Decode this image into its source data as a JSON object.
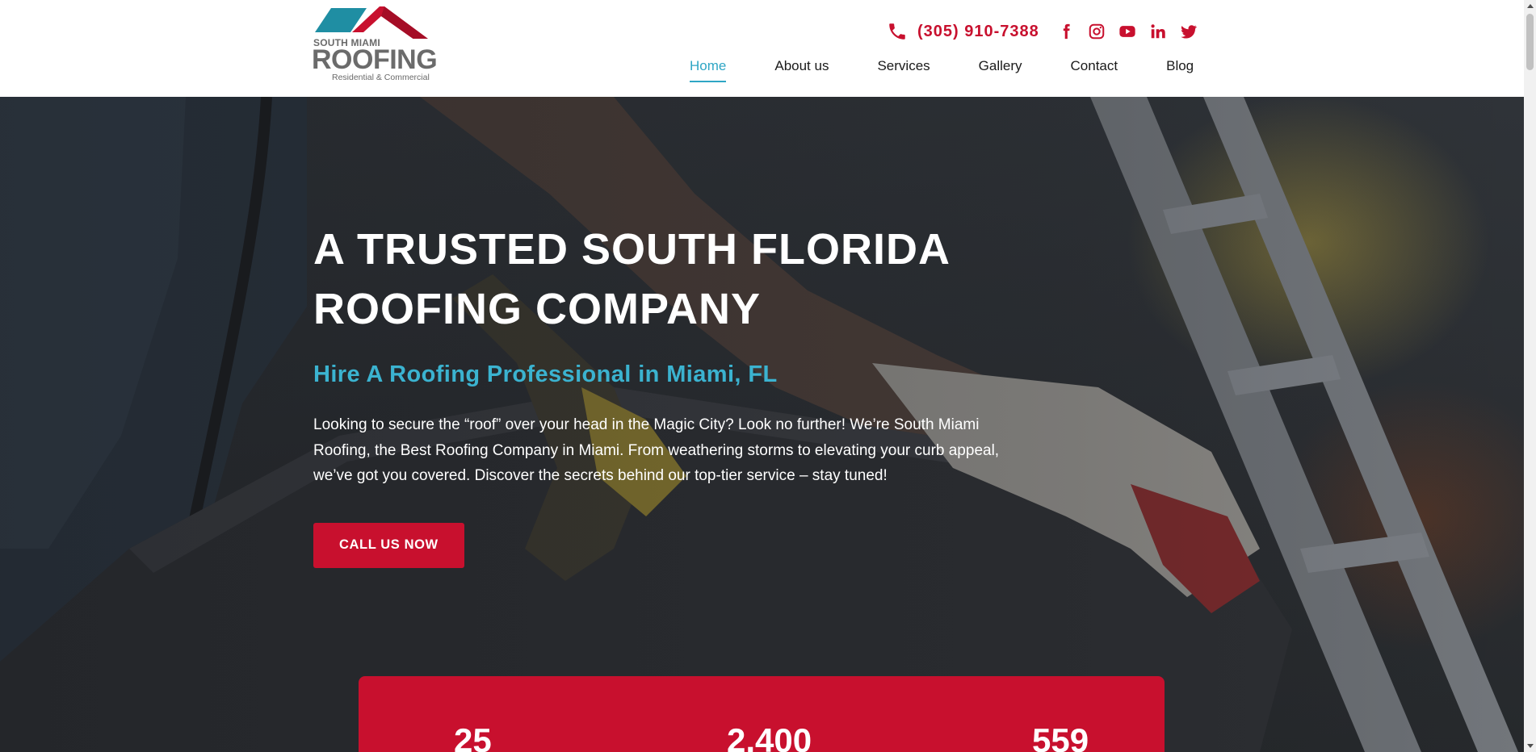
{
  "header": {
    "logo": {
      "line1": "SOUTH MIAMI",
      "line2": "ROOFING",
      "line3": "Residential & Commercial"
    },
    "phone": "(305) 910-7388",
    "social": [
      "facebook-icon",
      "instagram-icon",
      "youtube-icon",
      "linkedin-icon",
      "twitter-icon"
    ],
    "nav": [
      {
        "label": "Home",
        "active": true
      },
      {
        "label": "About us"
      },
      {
        "label": "Services"
      },
      {
        "label": "Gallery"
      },
      {
        "label": "Contact"
      },
      {
        "label": "Blog"
      }
    ]
  },
  "hero": {
    "title_line1": "A TRUSTED SOUTH FLORIDA",
    "title_line2": "ROOFING COMPANY",
    "subtitle": "Hire A Roofing Professional in Miami, FL",
    "text": "Looking to secure the “roof” over your head in the Magic City? Look no further! We’re South Miami Roofing, the Best Roofing Company in Miami. From weathering storms to elevating your curb appeal, we’ve got you covered. Discover the secrets behind our top-tier service – stay tuned!",
    "cta": "CALL US NOW"
  },
  "stats": [
    "25",
    "2,400",
    "559"
  ],
  "colors": {
    "brand_red": "#c8102e",
    "brand_teal": "#2fa6c5",
    "logo_gray": "#6b6b6b"
  }
}
